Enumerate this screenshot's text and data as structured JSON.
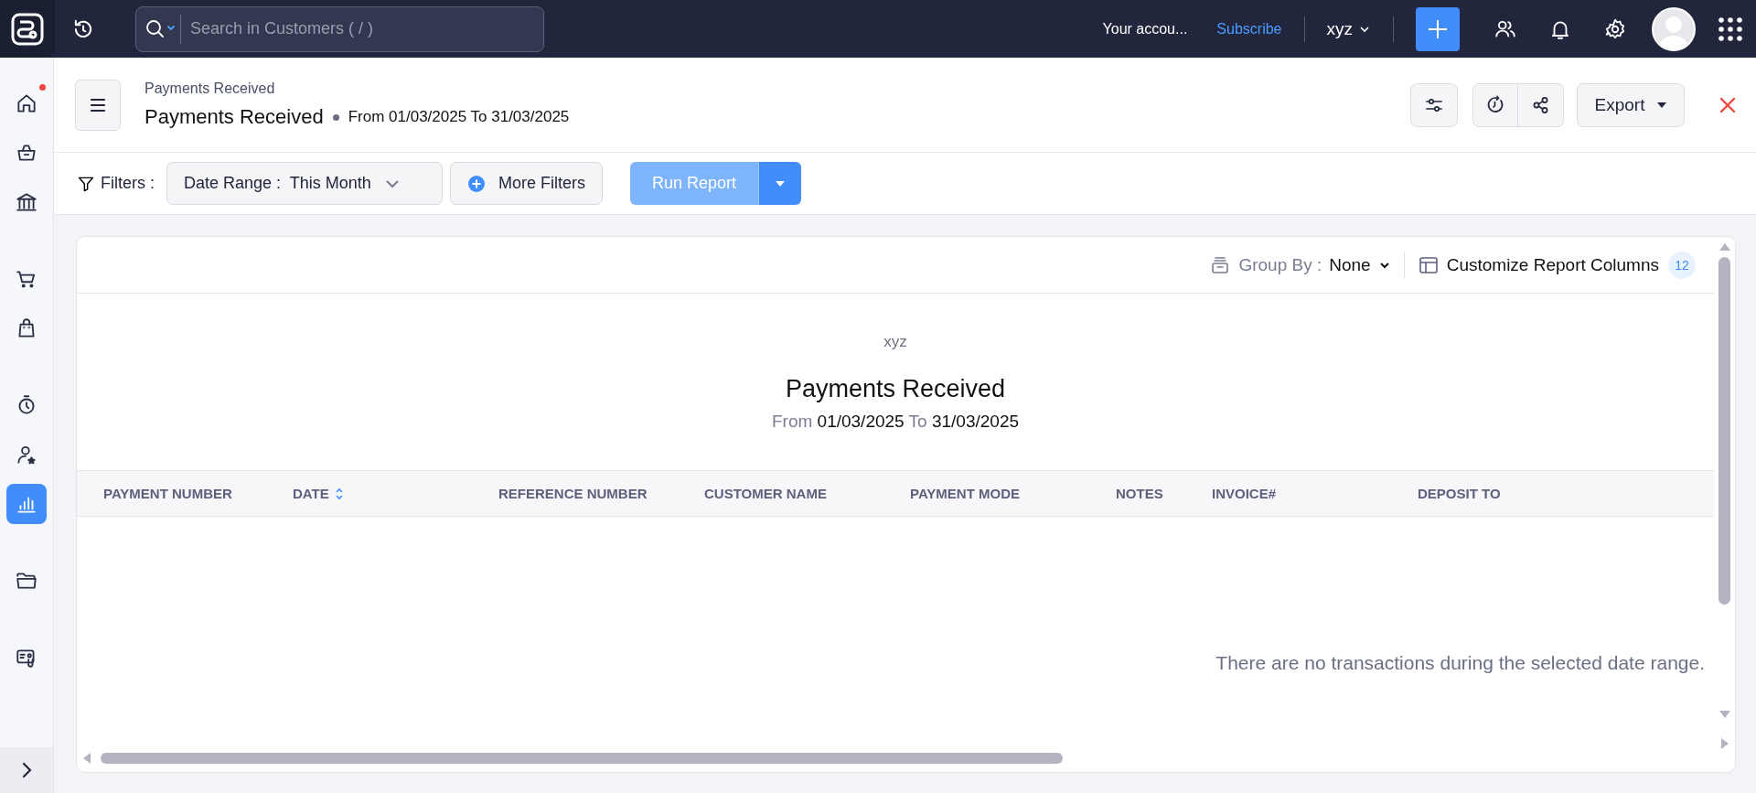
{
  "topbar": {
    "search": {
      "placeholder": "Search in Customers ( / )"
    },
    "account_notice": "Your accou...",
    "subscribe_link": "Subscribe",
    "org_name": "xyz"
  },
  "sidebar": {
    "groups": [
      {
        "items": [
          {
            "kind": "home",
            "notification": true,
            "selected": false
          },
          {
            "kind": "basket",
            "notification": false,
            "selected": false
          },
          {
            "kind": "bank",
            "notification": false,
            "selected": false
          }
        ]
      },
      {
        "items": [
          {
            "kind": "cart",
            "notification": false,
            "selected": false
          },
          {
            "kind": "bag",
            "notification": false,
            "selected": false
          }
        ]
      },
      {
        "items": [
          {
            "kind": "timer",
            "notification": false,
            "selected": false
          },
          {
            "kind": "user",
            "notification": false,
            "selected": false
          },
          {
            "kind": "reports",
            "notification": false,
            "selected": true
          }
        ]
      },
      {
        "items": [
          {
            "kind": "folder",
            "notification": false,
            "selected": false
          }
        ]
      },
      {
        "items": [
          {
            "kind": "card",
            "notification": false,
            "selected": false
          }
        ]
      }
    ]
  },
  "header": {
    "breadcrumb": "Payments Received",
    "title": "Payments Received",
    "period": "From 01/03/2025 To 31/03/2025",
    "export_button": "Export"
  },
  "filters": {
    "label": "Filters :",
    "date_range": {
      "label": "Date Range :",
      "value": "This Month"
    },
    "more_filters": "More Filters",
    "run_report": "Run Report"
  },
  "report": {
    "group_by": {
      "label": "Group By :",
      "value": "None"
    },
    "customize_columns": {
      "label": "Customize Report Columns",
      "count": "12"
    },
    "organization": "xyz",
    "title": "Payments Received",
    "period": {
      "from_label": "From",
      "from_date": "01/03/2025",
      "to_label": "To",
      "to_date": "31/03/2025"
    },
    "columns": [
      {
        "label": "PAYMENT NUMBER",
        "sortable": false
      },
      {
        "label": "DATE",
        "sortable": true
      },
      {
        "label": "REFERENCE NUMBER",
        "sortable": false
      },
      {
        "label": "CUSTOMER NAME",
        "sortable": false
      },
      {
        "label": "PAYMENT MODE",
        "sortable": false
      },
      {
        "label": "NOTES",
        "sortable": false
      },
      {
        "label": "INVOICE#",
        "sortable": false
      },
      {
        "label": "DEPOSIT TO",
        "sortable": false
      }
    ],
    "empty_message": "There are no transactions during the selected date range."
  }
}
